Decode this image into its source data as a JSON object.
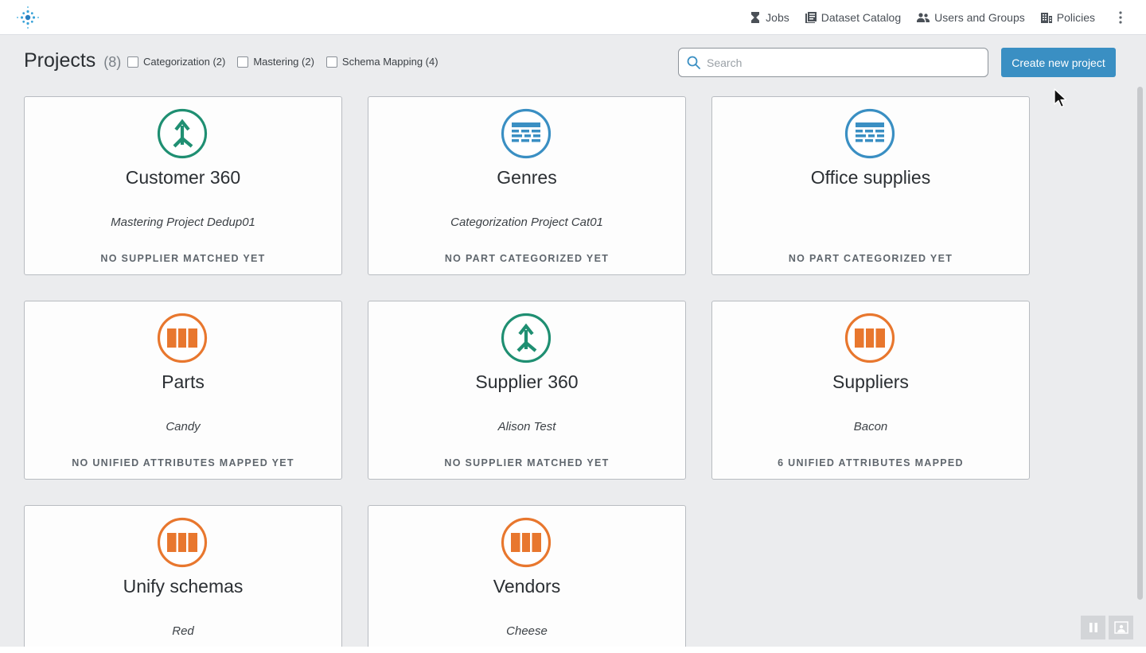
{
  "nav": {
    "jobs": "Jobs",
    "dataset_catalog": "Dataset Catalog",
    "users_and_groups": "Users and Groups",
    "policies": "Policies"
  },
  "header": {
    "title": "Projects",
    "count": "(8)",
    "filters": [
      {
        "label": "Categorization (2)",
        "checked": false
      },
      {
        "label": "Mastering (2)",
        "checked": false
      },
      {
        "label": "Schema Mapping (4)",
        "checked": false
      }
    ],
    "search_placeholder": "Search",
    "create_button": "Create new project"
  },
  "colors": {
    "mastering": "#1f8f72",
    "categorization": "#3a8fc3",
    "schema_mapping": "#e8772e",
    "accent": "#3a8fc3"
  },
  "projects": [
    {
      "title": "Customer 360",
      "subtitle": "Mastering Project Dedup01",
      "status": "NO SUPPLIER MATCHED YET",
      "icon": "mastering-icon"
    },
    {
      "title": "Genres",
      "subtitle": "Categorization Project Cat01",
      "status": "NO PART CATEGORIZED YET",
      "icon": "categorization-icon"
    },
    {
      "title": "Office supplies",
      "subtitle": "",
      "status": "NO PART CATEGORIZED YET",
      "icon": "categorization-icon"
    },
    {
      "title": "Parts",
      "subtitle": "Candy",
      "status": "NO UNIFIED ATTRIBUTES MAPPED YET",
      "icon": "schema-mapping-icon"
    },
    {
      "title": "Supplier 360",
      "subtitle": "Alison Test",
      "status": "NO SUPPLIER MATCHED YET",
      "icon": "mastering-icon"
    },
    {
      "title": "Suppliers",
      "subtitle": "Bacon",
      "status": "6 UNIFIED ATTRIBUTES MAPPED",
      "icon": "schema-mapping-icon"
    },
    {
      "title": "Unify schemas",
      "subtitle": "Red",
      "status": "",
      "icon": "schema-mapping-icon"
    },
    {
      "title": "Vendors",
      "subtitle": "Cheese",
      "status": "",
      "icon": "schema-mapping-icon"
    }
  ]
}
